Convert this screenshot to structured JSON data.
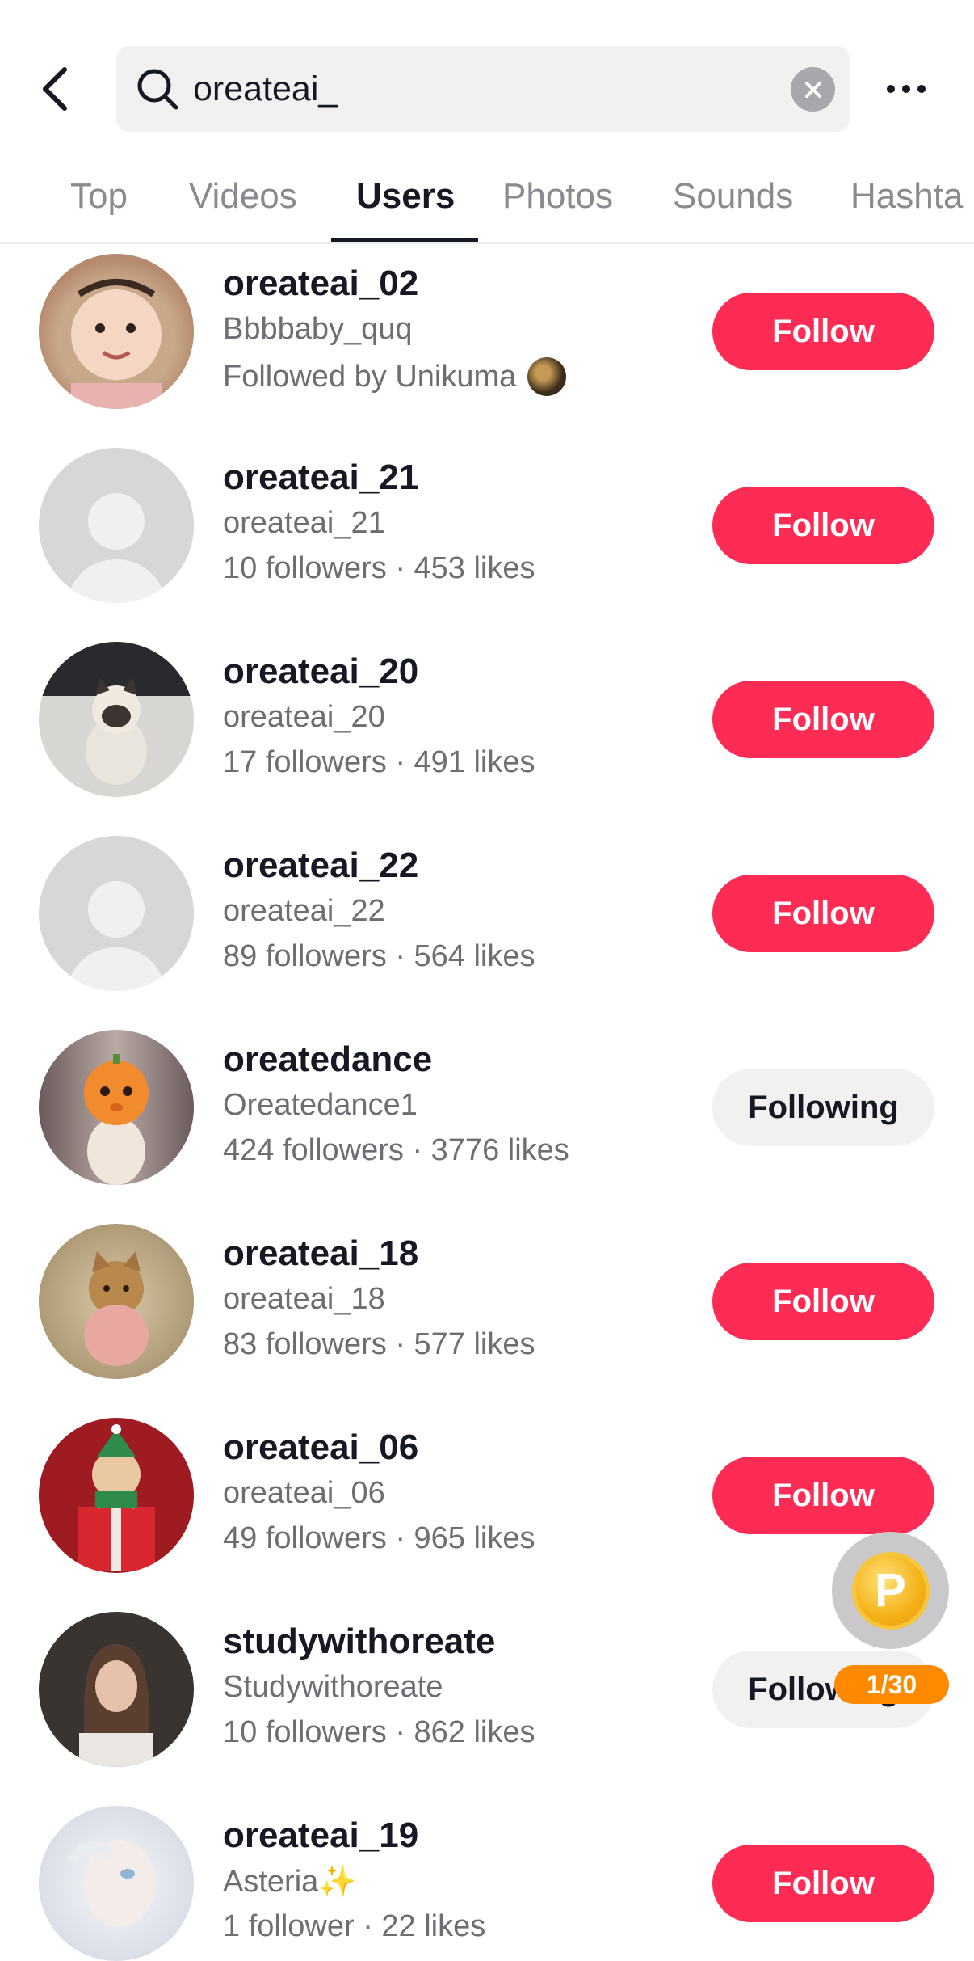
{
  "search": {
    "value": "oreateai_",
    "placeholder": "Search"
  },
  "tabs": [
    {
      "label": "Top"
    },
    {
      "label": "Videos"
    },
    {
      "label": "Users"
    },
    {
      "label": "Photos"
    },
    {
      "label": "Sounds"
    },
    {
      "label": "Hashta"
    }
  ],
  "active_tab": "Users",
  "users": [
    {
      "name": "oreateai_02",
      "handle": "Bbbbaby_quq",
      "stats": "Followed by Unikuma",
      "button": "Follow",
      "following": false
    },
    {
      "name": "oreateai_21",
      "handle": "oreateai_21",
      "stats": "10 followers · 453 likes",
      "button": "Follow",
      "following": false
    },
    {
      "name": "oreateai_20",
      "handle": "oreateai_20",
      "stats": "17 followers · 491 likes",
      "button": "Follow",
      "following": false
    },
    {
      "name": "oreateai_22",
      "handle": "oreateai_22",
      "stats": "89 followers · 564 likes",
      "button": "Follow",
      "following": false
    },
    {
      "name": "oreatedance",
      "handle": "Oreatedance1",
      "stats": "424 followers · 3776 likes",
      "button": "Following",
      "following": true
    },
    {
      "name": "oreateai_18",
      "handle": "oreateai_18",
      "stats": "83 followers · 577 likes",
      "button": "Follow",
      "following": false
    },
    {
      "name": "oreateai_06",
      "handle": "oreateai_06",
      "stats": "49 followers · 965 likes",
      "button": "Follow",
      "following": false
    },
    {
      "name": "studywithoreate",
      "handle": "Studywithoreate",
      "stats": "10 followers · 862 likes",
      "button": "Following",
      "following": true
    },
    {
      "name": "oreateai_19",
      "handle": "Asteria✨",
      "stats": "1 follower · 22 likes",
      "button": "Follow",
      "following": false
    }
  ],
  "reward": {
    "coin_letter": "P",
    "progress": "1/30"
  },
  "colors": {
    "accent": "#fe2c55",
    "following_bg": "#f1f1f2",
    "reward_badge": "#ff8a00"
  }
}
